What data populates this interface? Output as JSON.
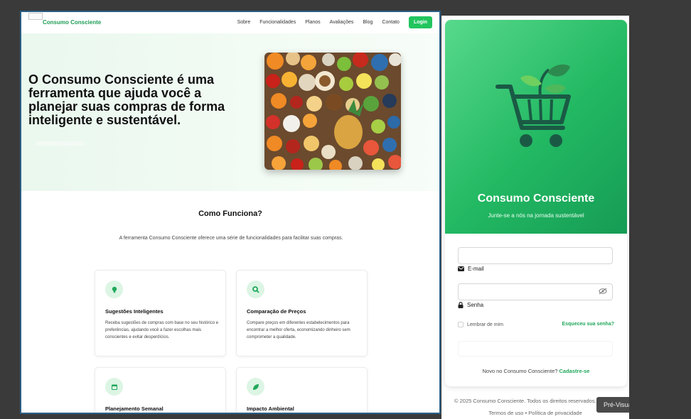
{
  "site": {
    "brand": "Consumo Consciente",
    "nav": [
      "Sobre",
      "Funcionalidades",
      "Planos",
      "Avaliações",
      "Blog",
      "Contato"
    ],
    "login_button": "Login"
  },
  "hero": {
    "title": "O Consumo Consciente é uma ferramenta que ajuda você a planejar suas compras de forma inteligente e sustentável."
  },
  "how_it_works": {
    "title": "Como Funciona?",
    "description": "A ferramenta Consumo Consciente oferece uma série de funcionalidades para facilitar suas compras.",
    "features": [
      {
        "icon": "lightbulb-icon",
        "title": "Sugestões Inteligentes",
        "description": "Receba sugestões de compras com base no seu histórico e preferências, ajudando você a fazer escolhas mais conscientes e evitar desperdícios."
      },
      {
        "icon": "search-icon",
        "title": "Comparação de Preços",
        "description": "Compare preços em diferentes estabelecimentos para encontrar a melhor oferta, economizando dinheiro sem comprometer a qualidade."
      },
      {
        "icon": "calendar-icon",
        "title": "Planejamento Semanal",
        "description": ""
      },
      {
        "icon": "leaf-icon",
        "title": "Impacto Ambiental",
        "description": ""
      }
    ]
  },
  "login": {
    "title": "Consumo Consciente",
    "subtitle": "Junte-se a nós na jornada sustentável",
    "email_label": "E-mail",
    "password_label": "Senha",
    "remember_label": "Lembrar de mim",
    "forgot_link": "Esqueceu sua senha?",
    "signup_text": "Novo no Consumo Consciente?",
    "signup_link": "Cadastre-se"
  },
  "footer": {
    "copyright": "© 2025 Consumo Consciente. Todos os direitos reservados.",
    "terms": "Termos de uso",
    "separator": "•",
    "privacy": "Política de privacidade"
  },
  "preview_button": "Pré-Visualizar",
  "colors": {
    "accent": "#22c55e",
    "accent_dark": "#169c55",
    "link": "#1fa85a"
  }
}
